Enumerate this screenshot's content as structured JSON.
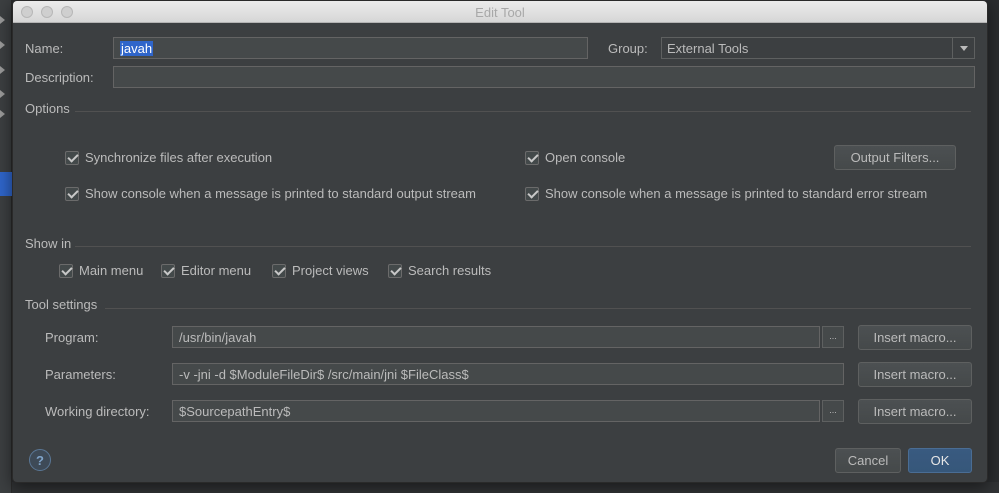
{
  "window": {
    "title": "Edit Tool"
  },
  "form": {
    "name_label": "Name:",
    "name_value": "javah",
    "group_label": "Group:",
    "group_value": "External Tools",
    "description_label": "Description:",
    "description_value": ""
  },
  "options": {
    "title": "Options",
    "sync_files": {
      "label": "Synchronize files after execution",
      "checked": true
    },
    "open_console": {
      "label": "Open console",
      "checked": true
    },
    "output_filters_label": "Output Filters...",
    "show_console_stdout": {
      "label": "Show console when a message is printed to standard output stream",
      "checked": true
    },
    "show_console_stderr": {
      "label": "Show console when a message is printed to standard error stream",
      "checked": true
    }
  },
  "show_in": {
    "title": "Show in",
    "main_menu": {
      "label": "Main menu",
      "checked": true
    },
    "editor_menu": {
      "label": "Editor menu",
      "checked": true
    },
    "project_views": {
      "label": "Project views",
      "checked": true
    },
    "search_results": {
      "label": "Search results",
      "checked": true
    }
  },
  "tool_settings": {
    "title": "Tool settings",
    "program_label": "Program:",
    "program_value": "/usr/bin/javah",
    "parameters_label": "Parameters:",
    "parameters_value": "-v -jni -d $ModuleFileDir$ /src/main/jni $FileClass$",
    "working_dir_label": "Working directory:",
    "working_dir_value": "$SourcepathEntry$",
    "browse_label": "...",
    "insert_macro_label": "Insert macro..."
  },
  "footer": {
    "help_symbol": "?",
    "cancel_label": "Cancel",
    "ok_label": "OK"
  },
  "colors": {
    "accent": "#2f65ca",
    "dialog_bg": "#3c3f41",
    "ok_button": "#36577a"
  }
}
